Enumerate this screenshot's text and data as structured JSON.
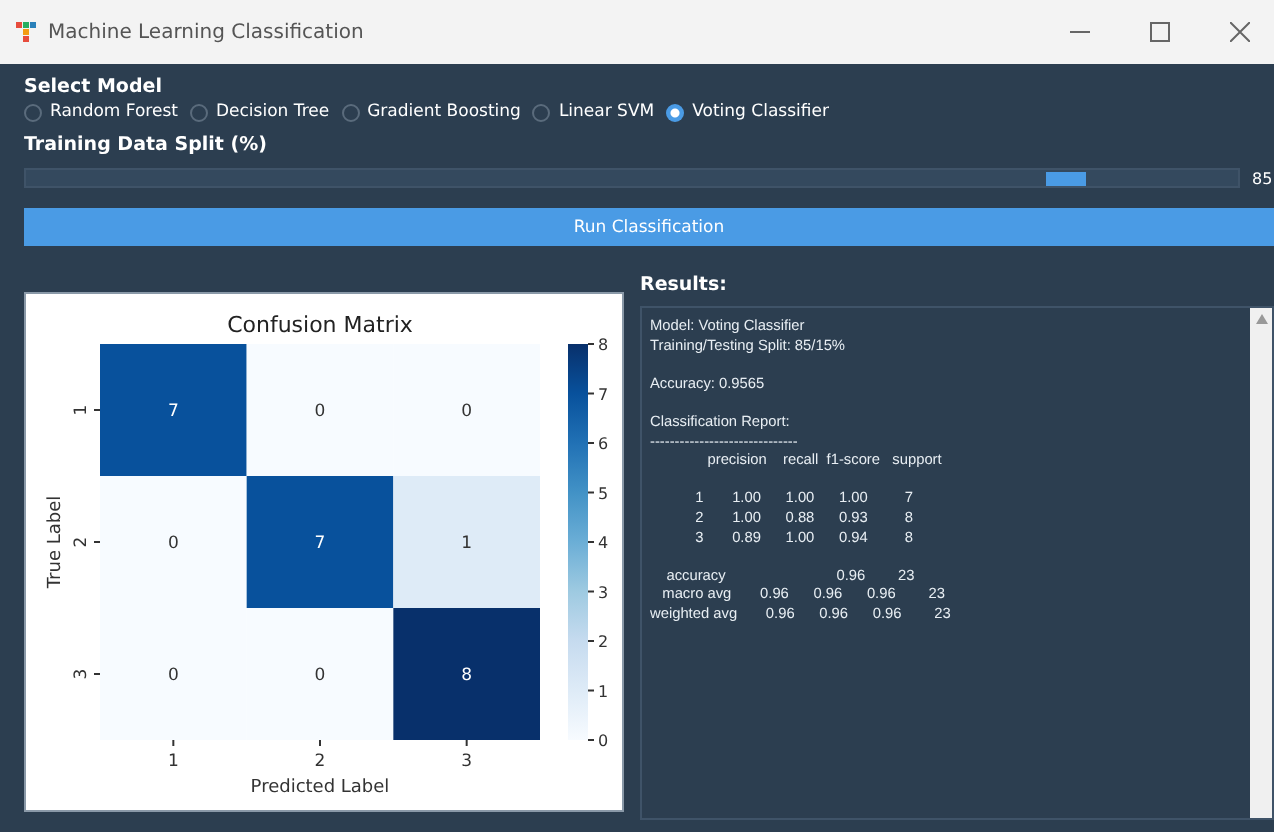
{
  "window": {
    "title": "Machine Learning Classification"
  },
  "model_section": {
    "label": "Select Model",
    "options": [
      {
        "label": "Random Forest",
        "selected": false
      },
      {
        "label": "Decision Tree",
        "selected": false
      },
      {
        "label": "Gradient Boosting",
        "selected": false
      },
      {
        "label": "Linear SVM",
        "selected": false
      },
      {
        "label": "Voting Classifier",
        "selected": true
      }
    ]
  },
  "split_section": {
    "label": "Training Data Split (%)",
    "level": 0.87,
    "reading": "85"
  },
  "run_button": "Run Classification",
  "confusion_matrix": {
    "title": "Confusion Matrix",
    "xlabel": "Predicted Label",
    "ylabel": "True Label",
    "x_labels": [
      "1",
      "2",
      "3"
    ],
    "y_labels": [
      "1",
      "2",
      "3"
    ],
    "cells": [
      [
        "7",
        "0",
        "0"
      ],
      [
        "0",
        "7",
        "1"
      ],
      [
        "0",
        "0",
        "8"
      ]
    ],
    "colorbar_ticks": [
      "8",
      "7",
      "6",
      "5",
      "4",
      "3",
      "2",
      "1",
      "0"
    ]
  },
  "results": {
    "label": "Results:",
    "blocks": [
      [
        "Model: Voting Classifier",
        "Training/Testing Split: 85/15%"
      ],
      [
        "Accuracy: 0.9565"
      ],
      [
        "Classification Report:",
        "------------------------------",
        "              precision    recall  f1-score   support"
      ],
      [
        "           1       1.00      1.00      1.00         7",
        "           2       1.00      0.88      0.93         8",
        "           3       0.89      1.00      0.94         8"
      ],
      [
        "    accuracy                           0.96        23",
        "   macro avg       0.96      0.96      0.96        23",
        "weighted avg       0.96      0.96      0.96        23"
      ]
    ]
  }
}
